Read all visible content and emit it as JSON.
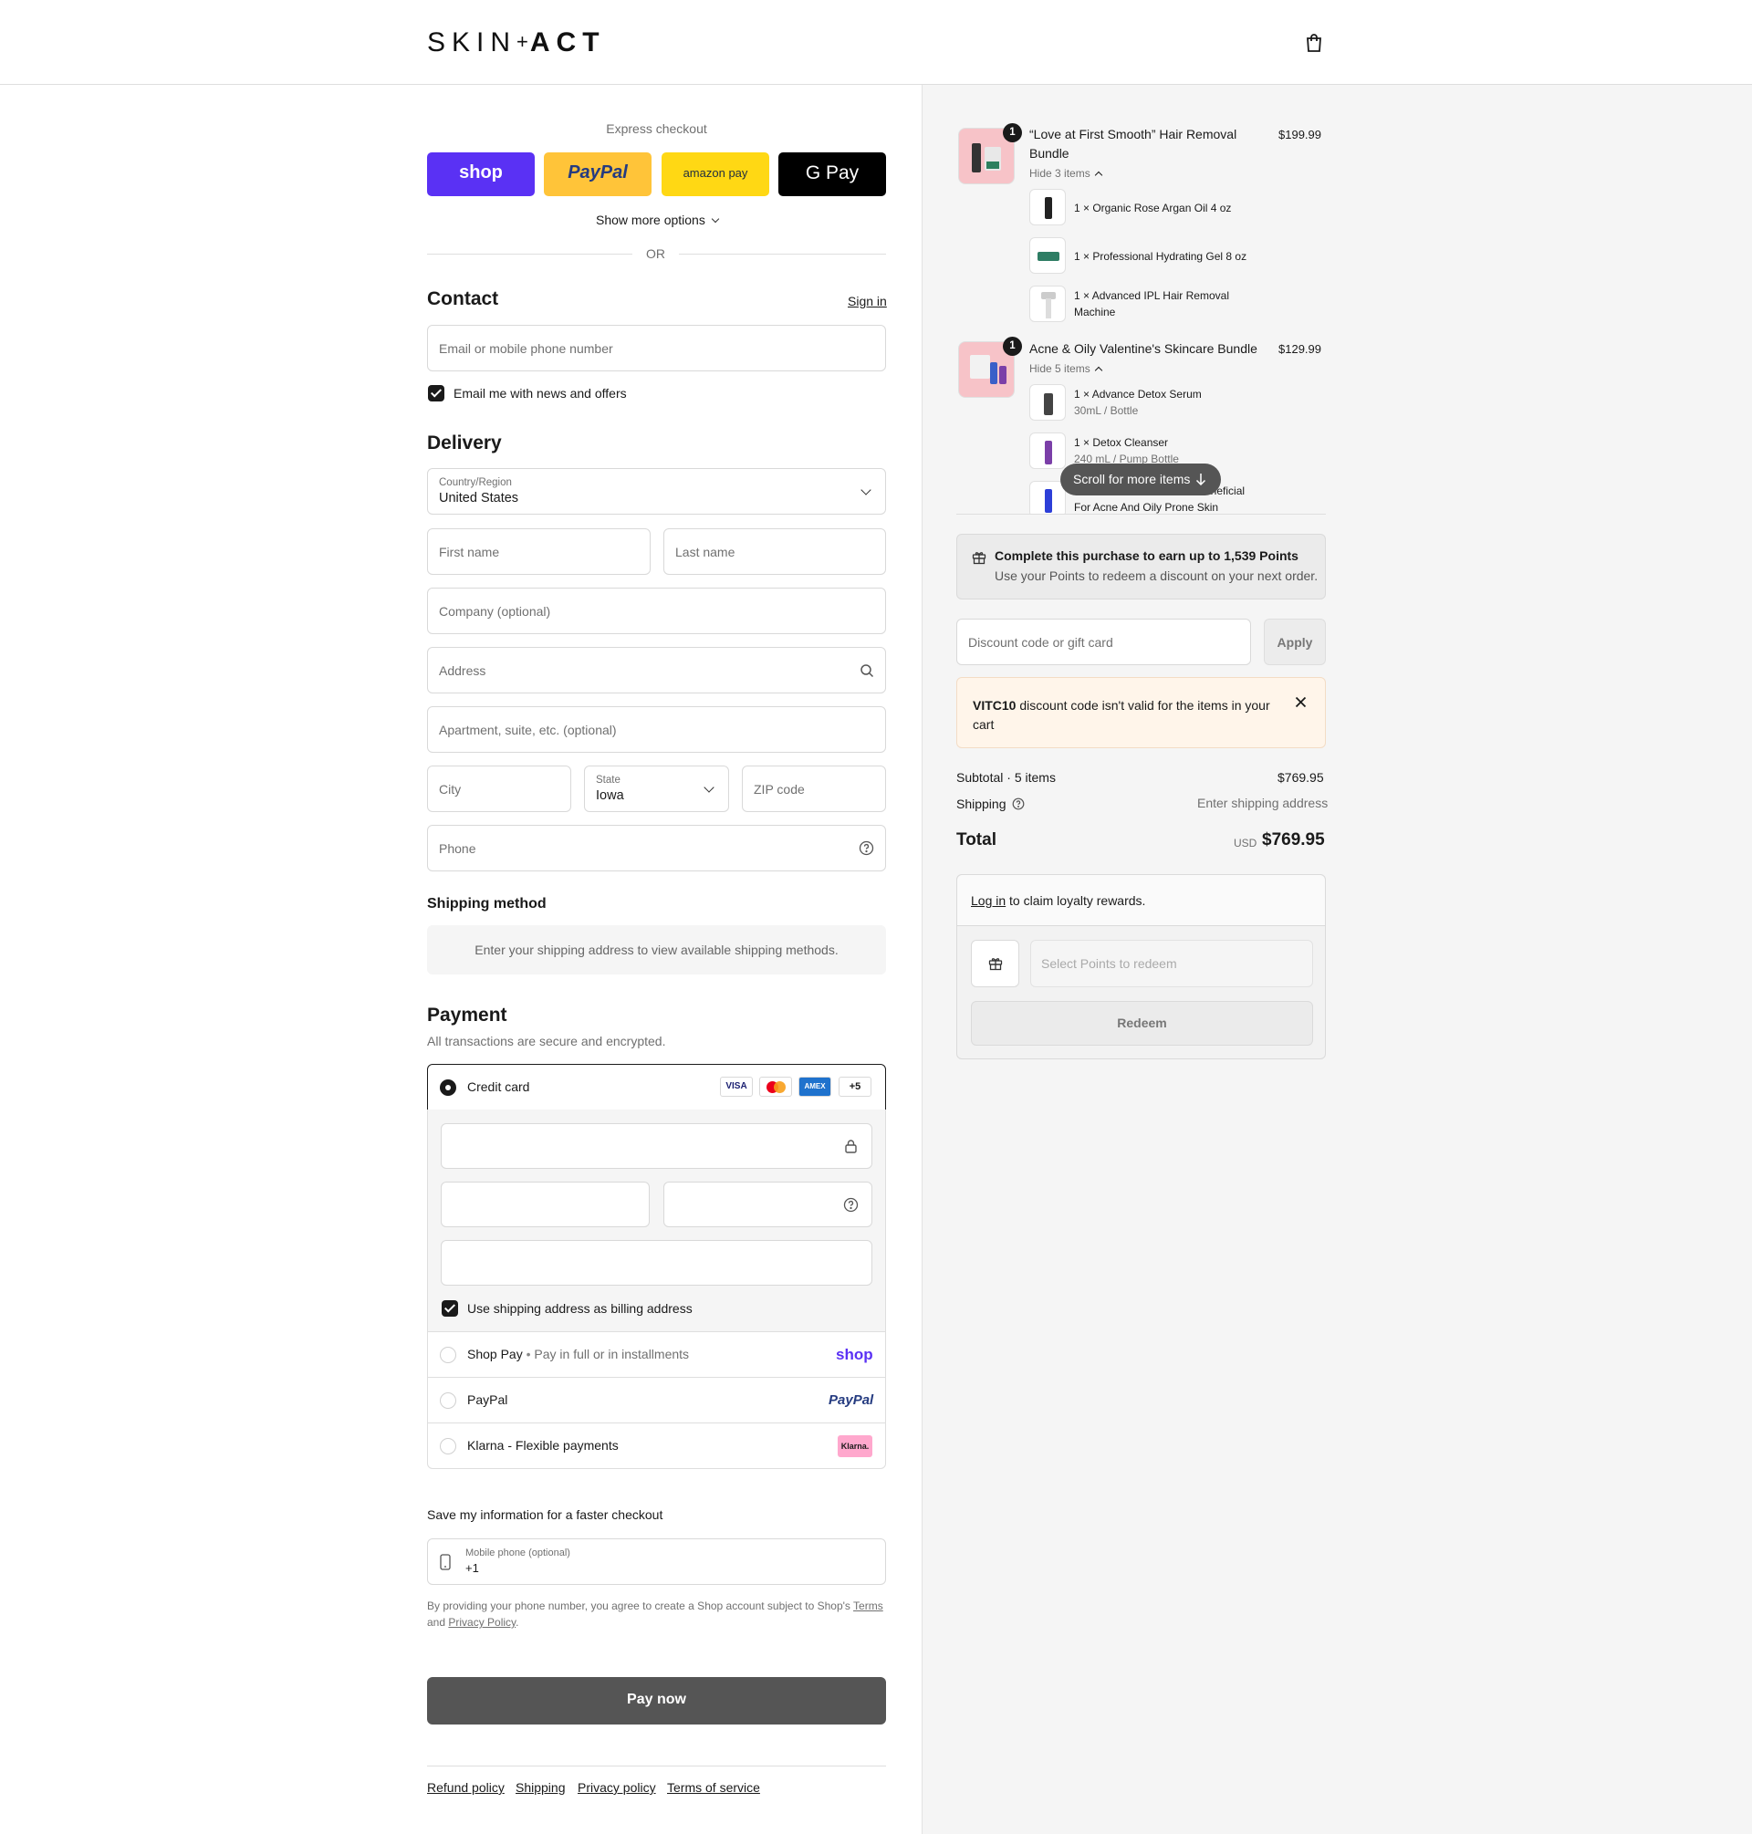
{
  "brand": {
    "logo_left": "SKIN",
    "logo_plus": "+",
    "logo_right": "ACT"
  },
  "express": {
    "title": "Express checkout",
    "buttons": [
      "shop",
      "PayPal",
      "amazon pay",
      "G Pay"
    ],
    "show_more": "Show more options",
    "or": "OR"
  },
  "contact": {
    "title": "Contact",
    "sign_in": "Sign in",
    "email_placeholder": "Email or mobile phone number",
    "newsletter": "Email me with news and offers"
  },
  "delivery": {
    "title": "Delivery",
    "country_label": "Country/Region",
    "country_value": "United States",
    "first_name": "First name",
    "last_name": "Last name",
    "company": "Company (optional)",
    "address": "Address",
    "apartment": "Apartment, suite, etc. (optional)",
    "city": "City",
    "state_label": "State",
    "state_value": "Iowa",
    "zip": "ZIP code",
    "phone": "Phone"
  },
  "shipping_method": {
    "title": "Shipping method",
    "notice": "Enter your shipping address to view available shipping methods."
  },
  "payment": {
    "title": "Payment",
    "subtitle": "All transactions are secure and encrypted.",
    "credit_card": "Credit card",
    "card_logos": [
      "VISA",
      "",
      "AMEX",
      "+5"
    ],
    "billing_same": "Use shipping address as billing address",
    "shop_pay": "Shop Pay",
    "shop_pay_note": "Pay in full or in installments",
    "shop_pay_logo": "shop",
    "paypal": "PayPal",
    "paypal_logo": "PayPal",
    "klarna": "Klarna - Flexible payments",
    "klarna_logo": "Klarna."
  },
  "save_info": {
    "title": "Save my information for a faster checkout",
    "mobile_label": "Mobile phone (optional)",
    "mobile_value": "+1",
    "disclaimer_1": "By providing your phone number, you agree to create a Shop account subject to Shop's",
    "terms": "Terms",
    "and": "and",
    "privacy": "Privacy Policy",
    "period": "."
  },
  "pay_now": "Pay now",
  "footer": [
    "Refund policy",
    "Shipping",
    "Privacy policy",
    "Terms of service"
  ],
  "cart": {
    "items": [
      {
        "qty": "1",
        "name_1": "“Love at First Smooth” Hair Removal",
        "name_2": "Bundle",
        "price": "$199.99",
        "toggle": "Hide 3 items",
        "sub": [
          {
            "line": "1 × Organic Rose Argan Oil 4 oz",
            "variant": ""
          },
          {
            "line": "1 × Professional Hydrating Gel 8 oz",
            "variant": ""
          },
          {
            "line": "1 × Advanced IPL Hair Removal",
            "variant": "Machine"
          }
        ]
      },
      {
        "qty": "1",
        "name_1": "Acne & Oily Valentine's Skincare Bundle",
        "price": "$129.99",
        "toggle": "Hide 5 items",
        "sub": [
          {
            "line": "1 × Advance Detox Serum",
            "variant": "30mL / Bottle"
          },
          {
            "line": "1 × Detox Cleanser",
            "variant": "240 mL / Pump Bottle"
          },
          {
            "line": "eneficial",
            "variant": "For Acne And Oily Prone Skin"
          }
        ]
      }
    ],
    "scroll_hint": "Scroll for more items"
  },
  "points_banner": {
    "title": "Complete this purchase to earn up to 1,539 Points",
    "subtitle": "Use your Points to redeem a discount on your next order."
  },
  "discount": {
    "placeholder": "Discount code or gift card",
    "apply": "Apply",
    "error_code": "VITC10",
    "error_text": " discount code isn't valid for the items in your",
    "error_text_2": "cart"
  },
  "summary": {
    "subtotal_label": "Subtotal · 5 items",
    "subtotal_value": "$769.95",
    "shipping_label": "Shipping",
    "shipping_value": "Enter shipping address",
    "total_label": "Total",
    "currency": "USD",
    "total_value": "$769.95"
  },
  "loyalty": {
    "login": "Log in",
    "claim": " to claim loyalty rewards.",
    "select_placeholder": "Select Points to redeem",
    "redeem": "Redeem"
  }
}
